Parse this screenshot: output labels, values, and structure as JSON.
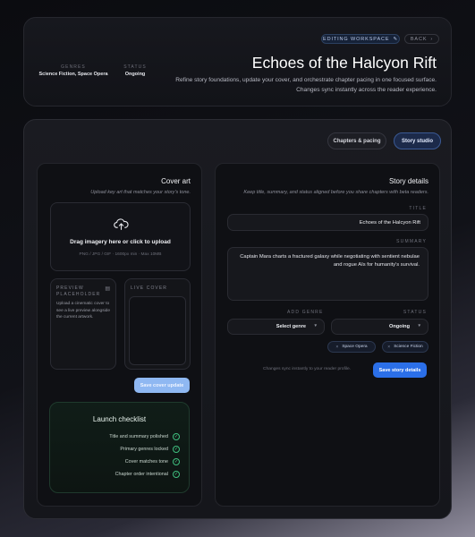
{
  "header": {
    "editing_label": "EDITING WORKSPACE",
    "back_label": "BACK",
    "title": "Echoes of the Halcyon Rift",
    "description": "Refine story foundations, update your cover, and orchestrate chapter pacing in one focused surface. Changes sync instantly across the reader experience.",
    "genres_label": "GENRES",
    "genres_value": "Science Fiction, Space Opera",
    "status_label": "STATUS",
    "status_value": "Ongoing"
  },
  "tabs": [
    {
      "label": "Chapters & pacing",
      "active": false
    },
    {
      "label": "Story studio",
      "active": true
    }
  ],
  "cover": {
    "title": "Cover art",
    "subtitle": "Upload key art that matches your story's tone.",
    "upload_main": "Drag imagery here or click to upload",
    "upload_sub": "PNG / JPG / GIF · 1600px min · Max 10MB",
    "preview_label": "PREVIEW PLACEHOLDER",
    "preview_text": "Upload a cinematic cover to see a live preview alongside the current artwork.",
    "live_label": "LIVE COVER",
    "save_button": "Save cover update"
  },
  "checklist": {
    "title": "Launch checklist",
    "items": [
      "Title and summary polished",
      "Primary genres locked",
      "Cover matches tone",
      "Chapter order intentional"
    ]
  },
  "details": {
    "title": "Story details",
    "subtitle": "Keep title, summary, and status aligned before you share chapters with beta readers.",
    "title_label": "TITLE",
    "title_value": "Echoes of the Halcyon Rift",
    "summary_label": "SUMMARY",
    "summary_value": "Captain Mara charts a fractured galaxy while negotiating with sentient nebulae and rogue AIs for humanity's survival.",
    "genre_label": "ADD GENRE",
    "genre_select": "Select genre",
    "status_label": "STATUS",
    "status_select": "Ongoing",
    "chips": [
      "Space Opera",
      "Science Fiction"
    ],
    "sync_note": "Changes sync instantly to your reader profile.",
    "save_button": "Save story details"
  },
  "colors": {
    "accent": "#2b6fe8",
    "accent_light": "#8fb8f2",
    "success": "#55d893"
  }
}
